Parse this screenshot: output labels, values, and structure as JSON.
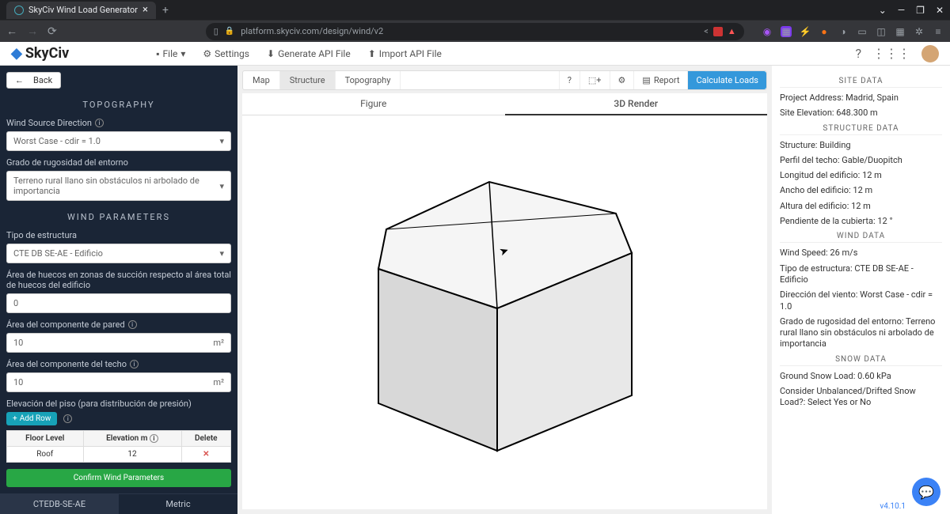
{
  "browser": {
    "tab_title": "SkyCiv Wind Load Generator",
    "url": "platform.skyciv.com/design/wind/v2"
  },
  "appbar": {
    "logo": "SkyCiv",
    "file": "File",
    "settings": "Settings",
    "gen_api": "Generate API File",
    "import_api": "Import API File"
  },
  "sidebar": {
    "back": "Back",
    "sect_topo": "TOPOGRAPHY",
    "wind_dir_label": "Wind Source Direction",
    "wind_dir_value": "Worst Case - cdir = 1.0",
    "rugosidad_label": "Grado de rugosidad del entorno",
    "rugosidad_value": "Terreno rural llano sin obstáculos ni arbolado de importancia",
    "sect_wind": "WIND PARAMETERS",
    "tipo_label": "Tipo de estructura",
    "tipo_value": "CTE DB SE-AE - Edificio",
    "area_huecos_label": "Área de huecos en zonas de succión respecto al área total de huecos del edificio",
    "area_huecos_value": "0",
    "area_pared_label": "Área del componente de pared",
    "area_pared_value": "10",
    "area_techo_label": "Área del componente del techo",
    "area_techo_value": "10",
    "unit_m2": "m²",
    "elev_label": "Elevación del piso (para distribución de presión)",
    "add_row": "Add Row",
    "th_floor": "Floor Level",
    "th_elev": "Elevation m",
    "th_del": "Delete",
    "row_floor": "Roof",
    "row_elev": "12",
    "confirm": "Confirm Wind Parameters",
    "btab1": "CTEDB-SE-AE",
    "btab2": "Metric"
  },
  "toolbar": {
    "map": "Map",
    "structure": "Structure",
    "topography": "Topography",
    "report": "Report",
    "calculate": "Calculate Loads"
  },
  "viewtabs": {
    "figure": "Figure",
    "render": "3D Render"
  },
  "rside": {
    "site_data": "SITE DATA",
    "addr": "Project Address: Madrid, Spain",
    "elev": "Site Elevation: 648.300 m",
    "struct_data": "STRUCTURE DATA",
    "struct": "Structure: Building",
    "perfil": "Perfil del techo: Gable/Duopitch",
    "longitud": "Longitud del edificio: 12 m",
    "ancho": "Ancho del edificio: 12 m",
    "altura": "Altura del edificio: 12 m",
    "pendiente": "Pendiente de la cubierta: 12 °",
    "wind_data": "WIND DATA",
    "wspeed": "Wind Speed: 26 m/s",
    "wtipo": "Tipo de estructura: CTE DB SE-AE - Edificio",
    "wdir": "Dirección del viento: Worst Case - cdir = 1.0",
    "wrug": "Grado de rugosidad del entorno: Terreno rural llano sin obstáculos ni arbolado de importancia",
    "snow_data": "SNOW DATA",
    "gsnow": "Ground Snow Load: 0.60 kPa",
    "unbal": "Consider Unbalanced/Drifted Snow Load?: Select Yes or No",
    "version": "v4.10.1"
  }
}
